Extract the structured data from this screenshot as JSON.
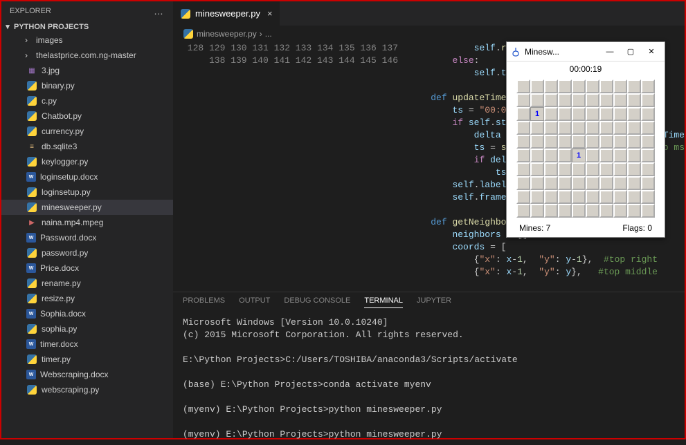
{
  "explorer": {
    "title": "EXPLORER",
    "more_label": "…",
    "section_title": "PYTHON PROJECTS",
    "items": [
      {
        "type": "folder",
        "label": "images",
        "indent": true
      },
      {
        "type": "folder",
        "label": "thelastprice.com.ng-master",
        "indent": true
      },
      {
        "type": "file",
        "icon": "img",
        "label": "3.jpg"
      },
      {
        "type": "file",
        "icon": "py",
        "label": "binary.py"
      },
      {
        "type": "file",
        "icon": "py",
        "label": "c.py"
      },
      {
        "type": "file",
        "icon": "py",
        "label": "Chatbot.py"
      },
      {
        "type": "file",
        "icon": "py",
        "label": "currency.py"
      },
      {
        "type": "file",
        "icon": "db",
        "label": "db.sqlite3"
      },
      {
        "type": "file",
        "icon": "py",
        "label": "keylogger.py"
      },
      {
        "type": "file",
        "icon": "docx",
        "label": "loginsetup.docx"
      },
      {
        "type": "file",
        "icon": "py",
        "label": "loginsetup.py"
      },
      {
        "type": "file",
        "icon": "py",
        "label": "minesweeper.py",
        "selected": true
      },
      {
        "type": "file",
        "icon": "media",
        "label": "naina.mp4.mpeg"
      },
      {
        "type": "file",
        "icon": "docx",
        "label": "Password.docx"
      },
      {
        "type": "file",
        "icon": "py",
        "label": "password.py"
      },
      {
        "type": "file",
        "icon": "docx",
        "label": "Price.docx"
      },
      {
        "type": "file",
        "icon": "py",
        "label": "rename.py"
      },
      {
        "type": "file",
        "icon": "py",
        "label": "resize.py"
      },
      {
        "type": "file",
        "icon": "docx",
        "label": "Sophia.docx"
      },
      {
        "type": "file",
        "icon": "py",
        "label": "sophia.py"
      },
      {
        "type": "file",
        "icon": "docx",
        "label": "timer.docx"
      },
      {
        "type": "file",
        "icon": "py",
        "label": "timer.py"
      },
      {
        "type": "file",
        "icon": "docx",
        "label": "Webscraping.docx"
      },
      {
        "type": "file",
        "icon": "py",
        "label": "webscraping.py"
      }
    ]
  },
  "editor": {
    "tab_label": "minesweeper.py",
    "breadcrumb_file": "minesweeper.py",
    "breadcrumb_sep": "›",
    "breadcrumb_more": "...",
    "line_start": 128,
    "line_end": 146
  },
  "panel": {
    "tabs": [
      "PROBLEMS",
      "OUTPUT",
      "DEBUG CONSOLE",
      "TERMINAL",
      "JUPYTER"
    ],
    "active_tab": 3,
    "terminal_lines": [
      "Microsoft Windows [Version 10.0.10240]",
      "(c) 2015 Microsoft Corporation. All rights reserved.",
      "",
      "E:\\Python Projects>C:/Users/TOSHIBA/anaconda3/Scripts/activate",
      "",
      "(base) E:\\Python Projects>conda activate myenv",
      "",
      "(myenv) E:\\Python Projects>python minesweeper.py",
      "",
      "(myenv) E:\\Python Projects>python minesweeper.py"
    ]
  },
  "game": {
    "title": "Minesw...",
    "timer": "00:00:19",
    "mines_label": "Mines: 7",
    "flags_label": "Flags: 0",
    "revealed_cells": [
      {
        "row": 2,
        "col": 1,
        "value": "1"
      },
      {
        "row": 5,
        "col": 4,
        "value": "1"
      }
    ],
    "rows": 10,
    "cols": 10
  }
}
